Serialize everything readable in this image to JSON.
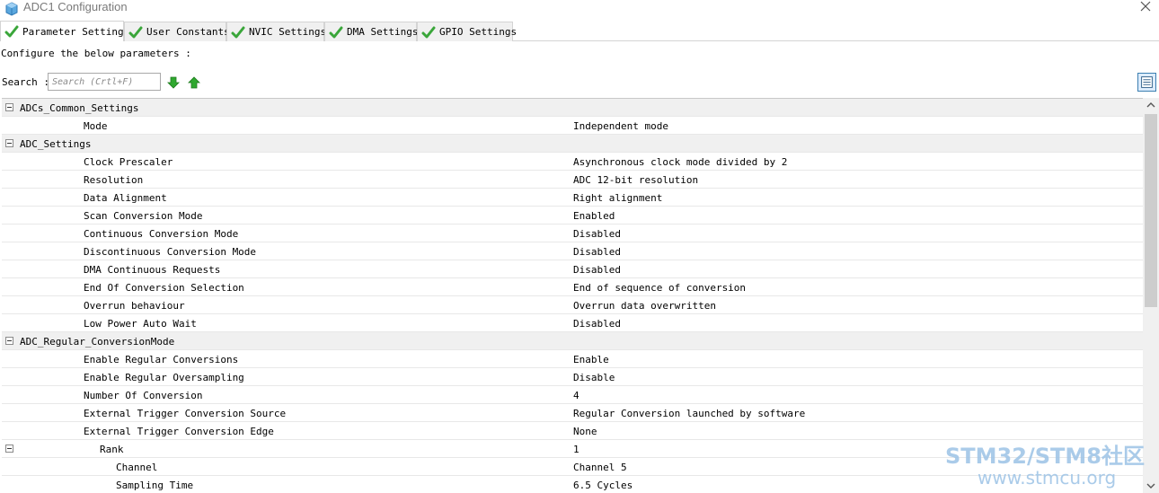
{
  "window": {
    "title": "ADC1 Configuration",
    "app_icon": "cube-icon",
    "close_icon": "close-icon"
  },
  "tabs": [
    {
      "label": "Parameter Settings",
      "active": true,
      "icon": "green-check-icon"
    },
    {
      "label": "User Constants",
      "active": false,
      "icon": "green-check-icon"
    },
    {
      "label": "NVIC Settings",
      "active": false,
      "icon": "green-check-icon"
    },
    {
      "label": "DMA Settings",
      "active": false,
      "icon": "green-check-icon"
    },
    {
      "label": "GPIO Settings",
      "active": false,
      "icon": "green-check-icon"
    }
  ],
  "description": "Configure the below parameters :",
  "search": {
    "label": "Search :",
    "placeholder": "Search (Crtl+F)",
    "down_icon": "green-arrow-down-icon",
    "up_icon": "green-arrow-up-icon",
    "view_icon": "list-view-icon"
  },
  "groups": {
    "common": {
      "name": "ADCs_Common_Settings",
      "params": [
        {
          "name": "Mode",
          "value": "Independent mode"
        }
      ]
    },
    "adc": {
      "name": "ADC_Settings",
      "params": [
        {
          "name": "Clock Prescaler",
          "value": "Asynchronous clock mode divided by 2"
        },
        {
          "name": "Resolution",
          "value": "ADC 12-bit resolution"
        },
        {
          "name": "Data Alignment",
          "value": "Right alignment"
        },
        {
          "name": "Scan Conversion Mode",
          "value": "Enabled"
        },
        {
          "name": "Continuous Conversion Mode",
          "value": "Disabled"
        },
        {
          "name": "Discontinuous Conversion Mode",
          "value": "Disabled"
        },
        {
          "name": "DMA Continuous Requests",
          "value": "Disabled"
        },
        {
          "name": "End Of Conversion Selection",
          "value": "End of sequence of conversion"
        },
        {
          "name": "Overrun behaviour",
          "value": "Overrun data overwritten"
        },
        {
          "name": "Low Power Auto Wait",
          "value": "Disabled"
        }
      ]
    },
    "regular": {
      "name": "ADC_Regular_ConversionMode",
      "params": [
        {
          "name": "Enable Regular Conversions",
          "value": "Enable"
        },
        {
          "name": "Enable Regular Oversampling",
          "value": "Disable"
        },
        {
          "name": "Number Of Conversion",
          "value": "4"
        },
        {
          "name": "External Trigger Conversion Source",
          "value": "Regular Conversion launched by software"
        },
        {
          "name": "External Trigger Conversion Edge",
          "value": "None"
        }
      ],
      "rank": {
        "name": "Rank",
        "value": "1",
        "params": [
          {
            "name": "Channel",
            "value": "Channel 5"
          },
          {
            "name": "Sampling Time",
            "value": "6.5 Cycles"
          }
        ]
      }
    }
  },
  "watermark": {
    "line1": "STM32/STM8社区",
    "line2": "www.stmcu.org"
  },
  "colors": {
    "check_green": "#3aa63a",
    "arrow_green": "#2fa82f",
    "group_bg": "#f0f0f0",
    "watermark": "#9cc3e6"
  }
}
